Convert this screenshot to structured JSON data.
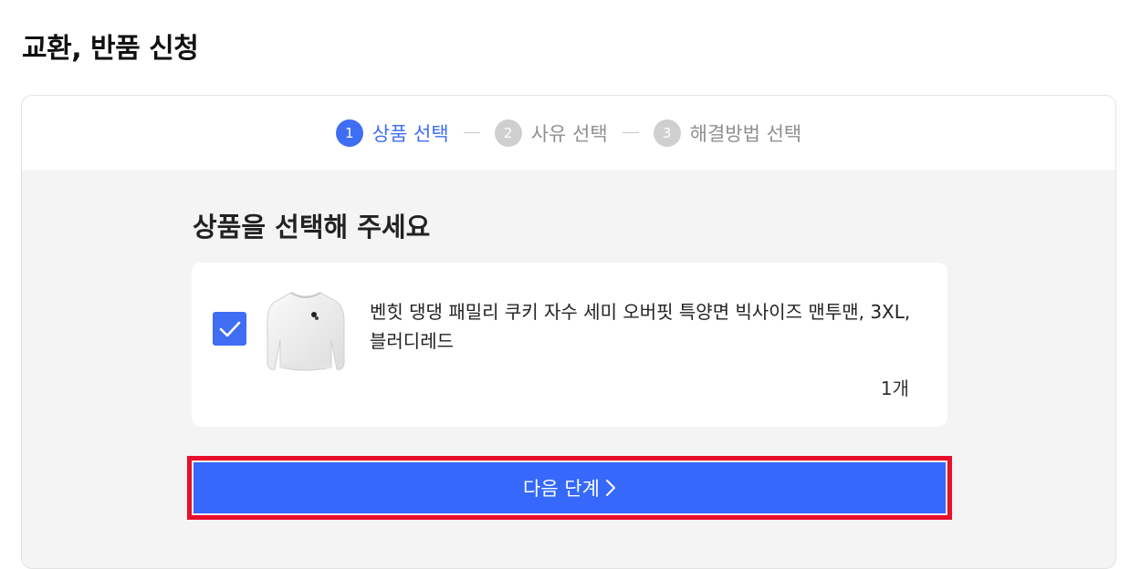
{
  "page": {
    "title": "교환, 반품 신청"
  },
  "stepper": {
    "steps": [
      {
        "number": "1",
        "label": "상품 선택",
        "active": true
      },
      {
        "number": "2",
        "label": "사유 선택",
        "active": false
      },
      {
        "number": "3",
        "label": "해결방법 선택",
        "active": false
      }
    ]
  },
  "section": {
    "title": "상품을 선택해 주세요"
  },
  "product": {
    "checked": true,
    "name": "벤힛 댕댕 패밀리 쿠키 자수 세미 오버핏 특양면 빅사이즈 맨투맨, 3XL, 블러디레드",
    "quantity": "1개",
    "thumbnail_icon": "white-sweatshirt-image"
  },
  "next_button": {
    "label": "다음 단계",
    "icon": "chevron-right-icon"
  },
  "colors": {
    "accent": "#3f6ef5",
    "button": "#3568fb",
    "highlight": "#e8102a",
    "content_bg": "#f4f4f4"
  }
}
